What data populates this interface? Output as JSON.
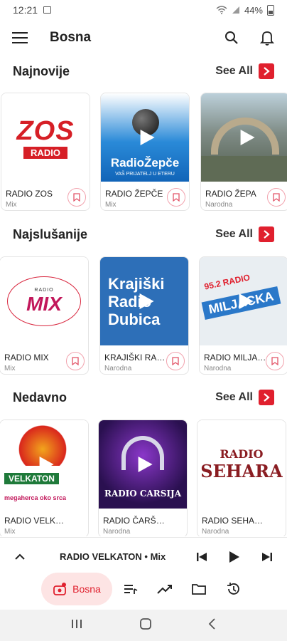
{
  "status_bar": {
    "time": "12:21",
    "battery": "44%"
  },
  "app_bar": {
    "title": "Bosna"
  },
  "sections": [
    {
      "title": "Najnovije",
      "see_all": "See All",
      "cards": [
        {
          "name": "RADIO ZOS",
          "genre": "Mix",
          "art_text": "ZOS",
          "art_sub": "RADIO"
        },
        {
          "name": "RADIO ŽEPČE",
          "genre": "Mix",
          "art_text": "RadioŽepče",
          "art_sub": "VAŠ PRIJATELJ U ETERU"
        },
        {
          "name": "RADIO ŽEPA",
          "genre": "Narodna"
        }
      ]
    },
    {
      "title": "Najslušanije",
      "see_all": "See All",
      "cards": [
        {
          "name": "RADIO MIX",
          "genre": "Mix",
          "art_text": "MIX",
          "art_sub": "RADIO"
        },
        {
          "name": "KRAJIŠKI RADIO DUBICA",
          "genre": "Narodna",
          "art_text": "Krajiški Radio Dubica"
        },
        {
          "name": "RADIO MILJACKA",
          "genre": "Narodna",
          "art_text": "MILJACKA",
          "art_sub": "95.2 RADIO"
        }
      ]
    },
    {
      "title": "Nedavno",
      "see_all": "See All",
      "cards": [
        {
          "name": "RADIO VELKATON",
          "genre": "Mix",
          "art_text": "VELKATON",
          "art_sub": "megaherca oko srca"
        },
        {
          "name": "RADIO ČARŠIJA",
          "genre": "Narodna",
          "art_text": "RADIO CARSIJA"
        },
        {
          "name": "RADIO SEHARA",
          "genre": "Narodna",
          "art_text": "SEHARA",
          "art_sub": "RADIO"
        }
      ]
    }
  ],
  "player": {
    "now_playing": "RADIO VELKATON • Mix"
  },
  "bottom_nav": {
    "active_label": "Bosna"
  },
  "colors": {
    "accent": "#e0202e",
    "pill_bg": "#fde4e4",
    "bookmark_border": "#f2a3ae"
  }
}
